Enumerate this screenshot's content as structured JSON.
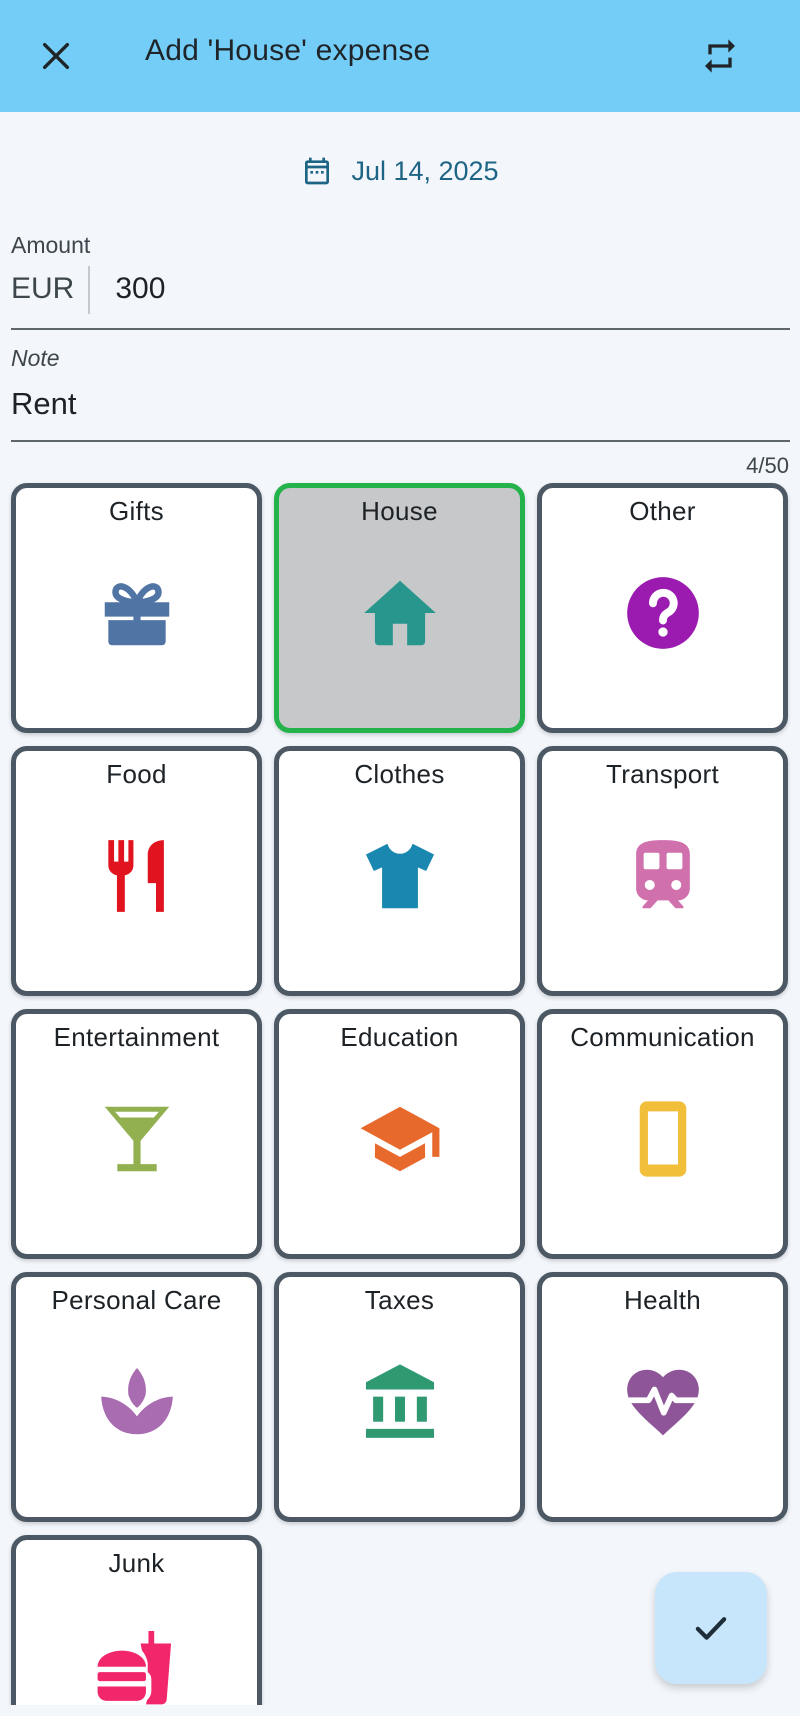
{
  "appbar": {
    "title": "Add 'House' expense",
    "close_icon": "close-icon",
    "switch_icon": "repeat-icon",
    "background": "#74cdf6"
  },
  "date": {
    "icon": "calendar-icon",
    "value": "Jul 14, 2025"
  },
  "amount": {
    "label": "Amount",
    "currency": "EUR",
    "value": "300"
  },
  "note": {
    "label": "Note",
    "value": "Rent",
    "counter": "4/50"
  },
  "categories": [
    {
      "label": "Gifts",
      "icon": "gift-icon",
      "color": "#5074a4",
      "selected": false
    },
    {
      "label": "House",
      "icon": "house-icon",
      "color": "#28968c",
      "selected": true
    },
    {
      "label": "Other",
      "icon": "question-icon",
      "color": "#9b1bb0",
      "selected": false
    },
    {
      "label": "Food",
      "icon": "fork-knife-icon",
      "color": "#e0131e",
      "selected": false
    },
    {
      "label": "Clothes",
      "icon": "tshirt-icon",
      "color": "#1a87b0",
      "selected": false
    },
    {
      "label": "Transport",
      "icon": "train-icon",
      "color": "#d070ac",
      "selected": false
    },
    {
      "label": "Entertainment",
      "icon": "cocktail-icon",
      "color": "#92b050",
      "selected": false
    },
    {
      "label": "Education",
      "icon": "graduation-cap-icon",
      "color": "#e8692c",
      "selected": false
    },
    {
      "label": "Communication",
      "icon": "phone-icon",
      "color": "#f2bf3a",
      "selected": false
    },
    {
      "label": "Personal Care",
      "icon": "lotus-icon",
      "color": "#a96cb1",
      "selected": false
    },
    {
      "label": "Taxes",
      "icon": "bank-icon",
      "color": "#2f9a72",
      "selected": false
    },
    {
      "label": "Health",
      "icon": "heart-pulse-icon",
      "color": "#8e5598",
      "selected": false
    },
    {
      "label": "Junk",
      "icon": "fast-food-icon",
      "color": "#f2266a",
      "selected": false
    }
  ],
  "fab": {
    "icon": "check-icon",
    "background": "#c8e6fb"
  },
  "colors": {
    "tile_border": "#4c5965",
    "selected_border": "#24b24a",
    "selected_background": "#c6c8ca",
    "date_text": "#1e6585"
  }
}
